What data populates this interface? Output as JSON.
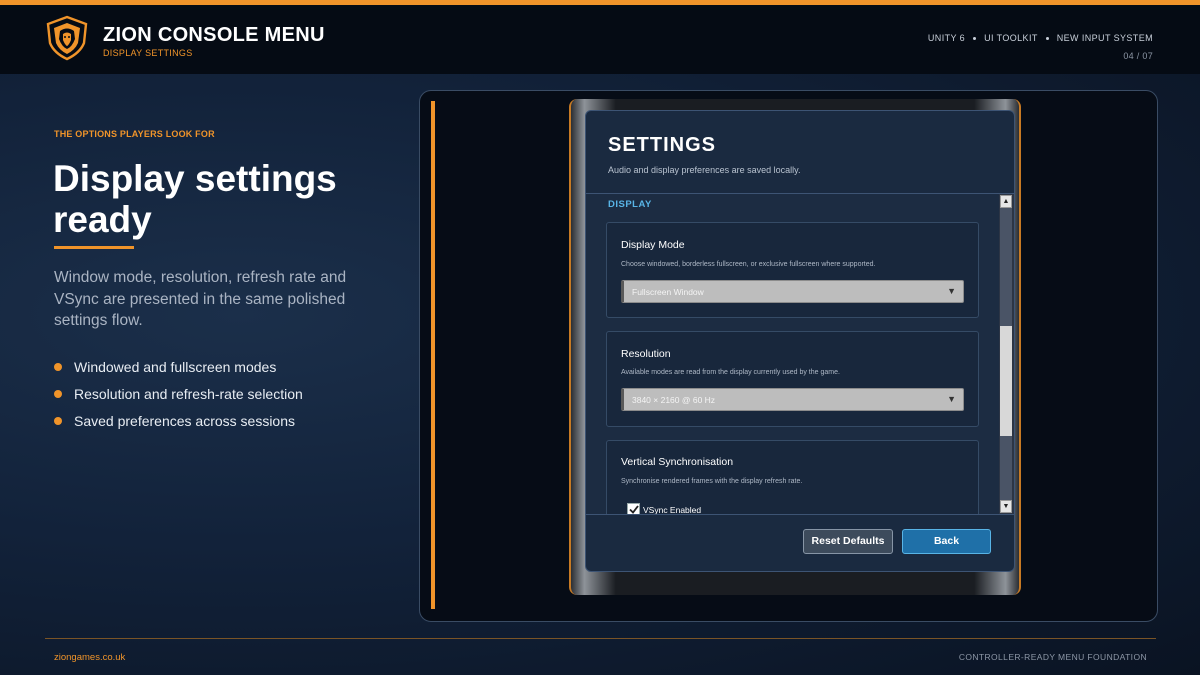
{
  "header": {
    "brand_title": "ZION CONSOLE MENU",
    "brand_subtitle": "DISPLAY SETTINGS",
    "tech_items": [
      "UNITY 6",
      "UI TOOLKIT",
      "NEW INPUT SYSTEM"
    ],
    "page_indicator": "04 / 07"
  },
  "intro": {
    "eyebrow": "THE OPTIONS PLAYERS LOOK FOR",
    "headline": "Display settings ready",
    "description": "Window mode, resolution, refresh rate and VSync are presented in the same polished settings flow.",
    "bullets": [
      "Windowed and fullscreen modes",
      "Resolution and refresh-rate selection",
      "Saved preferences across sessions"
    ]
  },
  "settings_panel": {
    "title": "SETTINGS",
    "subtitle": "Audio and display preferences are saved locally.",
    "section_label": "DISPLAY",
    "display_mode": {
      "title": "Display Mode",
      "description": "Choose windowed, borderless fullscreen, or exclusive fullscreen where supported.",
      "selected": "Fullscreen Window"
    },
    "resolution": {
      "title": "Resolution",
      "description": "Available modes are read from the display currently used by the game.",
      "selected": "3840 × 2160 @ 60 Hz"
    },
    "vsync": {
      "title": "Vertical Synchronisation",
      "description": "Synchronise rendered frames with the display refresh rate.",
      "checkbox_label": "VSync Enabled",
      "checked": true
    },
    "scroll_up": "▲",
    "scroll_down": "▼",
    "dropdown_arrow": "▼",
    "buttons": {
      "reset": "Reset Defaults",
      "back": "Back"
    }
  },
  "footer": {
    "website": "ziongames.co.uk",
    "tagline": "CONTROLLER-READY MENU FOUNDATION"
  },
  "colors": {
    "accent": "#f0942a",
    "link_blue": "#58b4e6",
    "primary_button": "#1f70a8"
  },
  "icons": [
    "lion-logo-icon",
    "checkmark-icon"
  ]
}
